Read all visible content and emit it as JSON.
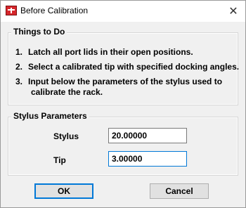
{
  "window": {
    "title": "Before Calibration"
  },
  "title_bar": {
    "close_glyph": "✕"
  },
  "things_to_do": {
    "title": "Things to Do",
    "items": [
      {
        "num": "1.",
        "text": "Latch all port lids in their open positions.",
        "cont": ""
      },
      {
        "num": "2.",
        "text": "Select a calibrated tip with specified docking angles.",
        "cont": ""
      },
      {
        "num": "3.",
        "text": "Input below the parameters of the stylus used to",
        "cont": "calibrate the rack."
      }
    ]
  },
  "stylus_parameters": {
    "title": "Stylus Parameters",
    "stylus": {
      "label": "Stylus",
      "value": "20.00000"
    },
    "tip": {
      "label": "Tip",
      "value": "3.00000"
    }
  },
  "buttons": {
    "ok": "OK",
    "cancel": "Cancel"
  },
  "colors": {
    "accent": "#0078d7",
    "app_icon": "#d6262b"
  }
}
